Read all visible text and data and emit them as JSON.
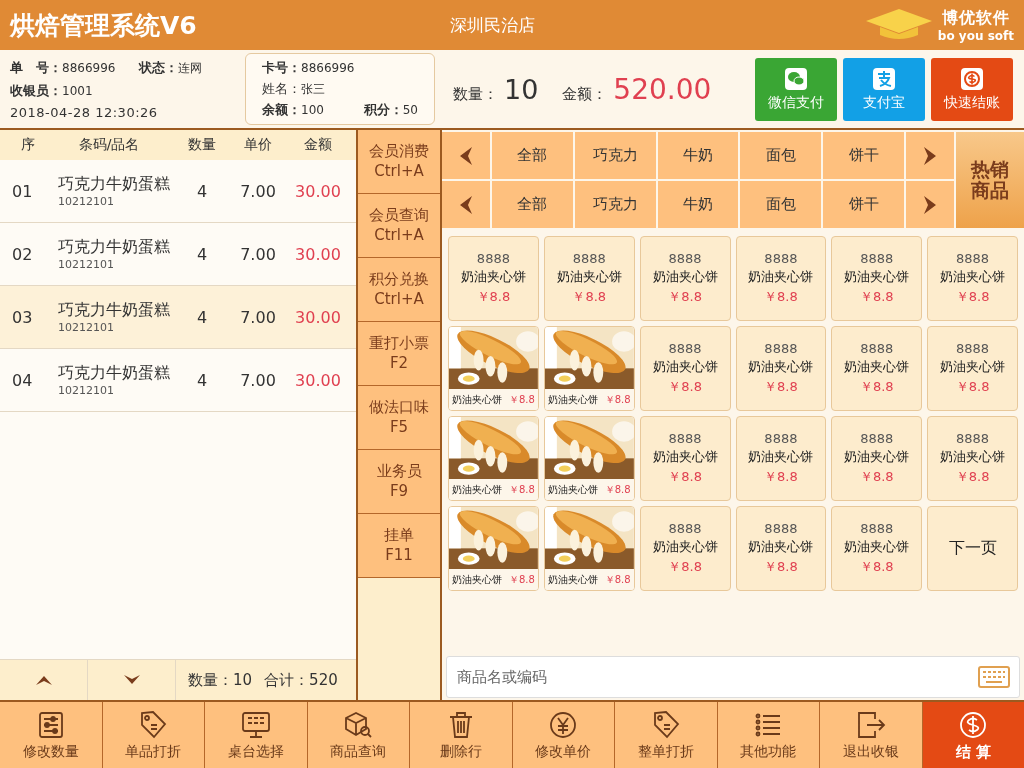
{
  "header": {
    "title": "烘焙管理系统V6",
    "store": "深圳民治店",
    "brand": "博优软件",
    "brand_sub": "bo you soft"
  },
  "order_info": {
    "order_no_label": "单　号：",
    "order_no": "8866996",
    "status_label": "状态：",
    "status": "连网",
    "cashier_label": "收银员：",
    "cashier": "1001",
    "datetime": "2018-04-28  12:30:26"
  },
  "member": {
    "card_label": "卡号：",
    "card": "8866996",
    "name_label": "姓名：",
    "name": "张三",
    "balance_label": "余额：",
    "balance": "100",
    "points_label": "积分：",
    "points": "50"
  },
  "totals": {
    "qty_label": "数量：",
    "qty": "10",
    "amount_label": "金额：",
    "amount": "520.00"
  },
  "pay_buttons": [
    {
      "kind": "wechat",
      "label": "微信支付"
    },
    {
      "kind": "alipay",
      "label": "支付宝"
    },
    {
      "kind": "quick",
      "label": "快速结账"
    }
  ],
  "table": {
    "columns": [
      "序",
      "条码/品名",
      "数量",
      "单价",
      "金额"
    ],
    "rows": [
      {
        "no": "01",
        "name": "巧克力牛奶蛋糕",
        "code": "10212101",
        "qty": "4",
        "price": "7.00",
        "amount": "30.00",
        "selected": false
      },
      {
        "no": "02",
        "name": "巧克力牛奶蛋糕",
        "code": "10212101",
        "qty": "4",
        "price": "7.00",
        "amount": "30.00",
        "selected": false
      },
      {
        "no": "03",
        "name": "巧克力牛奶蛋糕",
        "code": "10212101",
        "qty": "4",
        "price": "7.00",
        "amount": "30.00",
        "selected": true
      },
      {
        "no": "04",
        "name": "巧克力牛奶蛋糕",
        "code": "10212101",
        "qty": "4",
        "price": "7.00",
        "amount": "30.00",
        "selected": false
      }
    ],
    "footer": {
      "qty": "数量：10",
      "total": "合计：520"
    }
  },
  "side_buttons": [
    {
      "label": "会员消费",
      "shortcut": "Ctrl+A"
    },
    {
      "label": "会员查询",
      "shortcut": "Ctrl+A"
    },
    {
      "label": "积分兑换",
      "shortcut": "Ctrl+A"
    },
    {
      "label": "重打小票",
      "shortcut": "F2"
    },
    {
      "label": "做法口味",
      "shortcut": "F5"
    },
    {
      "label": "业务员",
      "shortcut": "F9"
    },
    {
      "label": "挂单",
      "shortcut": "F11"
    }
  ],
  "category_rows": [
    [
      "全部",
      "巧克力",
      "牛奶",
      "面包",
      "饼干"
    ],
    [
      "全部",
      "巧克力",
      "牛奶",
      "面包",
      "饼干"
    ]
  ],
  "hot_button": "热销商品",
  "products": [
    {
      "kind": "text",
      "code": "8888",
      "name": "奶油夹心饼",
      "price": "￥8.8"
    },
    {
      "kind": "text",
      "code": "8888",
      "name": "奶油夹心饼",
      "price": "￥8.8"
    },
    {
      "kind": "text",
      "code": "8888",
      "name": "奶油夹心饼",
      "price": "￥8.8"
    },
    {
      "kind": "text",
      "code": "8888",
      "name": "奶油夹心饼",
      "price": "￥8.8"
    },
    {
      "kind": "text",
      "code": "8888",
      "name": "奶油夹心饼",
      "price": "￥8.8"
    },
    {
      "kind": "text",
      "code": "8888",
      "name": "奶油夹心饼",
      "price": "￥8.8"
    },
    {
      "name": "奶油夹心饼",
      "price": "￥8.8"
    },
    {
      "name": "奶油夹心饼",
      "price": "￥8.8"
    },
    {
      "kind": "text",
      "code": "8888",
      "name": "奶油夹心饼",
      "price": "￥8.8"
    },
    {
      "kind": "text",
      "code": "8888",
      "name": "奶油夹心饼",
      "price": "￥8.8"
    },
    {
      "kind": "text",
      "code": "8888",
      "name": "奶油夹心饼",
      "price": "￥8.8"
    },
    {
      "kind": "text",
      "code": "8888",
      "name": "奶油夹心饼",
      "price": "￥8.8"
    },
    {
      "name": "奶油夹心饼",
      "price": "￥8.8"
    },
    {
      "name": "奶油夹心饼",
      "price": "￥8.8"
    },
    {
      "kind": "text",
      "code": "8888",
      "name": "奶油夹心饼",
      "price": "￥8.8"
    },
    {
      "kind": "text",
      "code": "8888",
      "name": "奶油夹心饼",
      "price": "￥8.8"
    },
    {
      "kind": "text",
      "code": "8888",
      "name": "奶油夹心饼",
      "price": "￥8.8"
    },
    {
      "kind": "text",
      "code": "8888",
      "name": "奶油夹心饼",
      "price": "￥8.8"
    },
    {
      "name": "奶油夹心饼",
      "price": "￥8.8"
    },
    {
      "name": "奶油夹心饼",
      "price": "￥8.8"
    },
    {
      "kind": "text",
      "code": "8888",
      "name": "奶油夹心饼",
      "price": "￥8.8"
    },
    {
      "kind": "text",
      "code": "8888",
      "name": "奶油夹心饼",
      "price": "￥8.8"
    },
    {
      "kind": "text",
      "code": "8888",
      "name": "奶油夹心饼",
      "price": "￥8.8"
    },
    {
      "kind": "next",
      "label": "下一页"
    }
  ],
  "search": {
    "placeholder": "商品名或编码"
  },
  "toolbar": [
    {
      "label": "修改数量",
      "primary": false
    },
    {
      "label": "单品打折",
      "primary": false
    },
    {
      "label": "桌台选择",
      "primary": false
    },
    {
      "label": "商品查询",
      "primary": false
    },
    {
      "label": "删除行",
      "primary": false
    },
    {
      "label": "修改单价",
      "primary": false
    },
    {
      "label": "整单打折",
      "primary": false
    },
    {
      "label": "其他功能",
      "primary": false
    },
    {
      "label": "退出收银",
      "primary": false
    },
    {
      "label": "结 算",
      "primary": true
    }
  ]
}
